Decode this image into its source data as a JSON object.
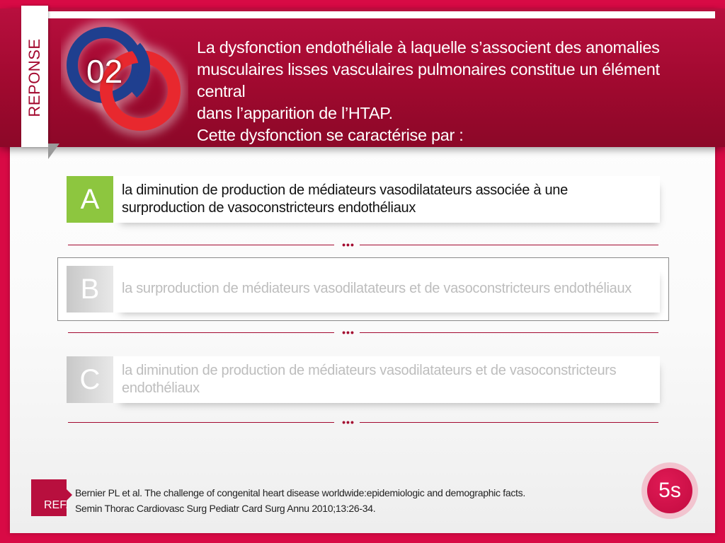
{
  "header": {
    "tab_label": "REPONSE",
    "question_number": "02",
    "question_lines": [
      "La dysfonction endothéliale à laquelle s’associent des anomalies",
      "musculaires lisses vasculaires pulmonaires constitue un élément central",
      "dans l’apparition de l’HTAP.",
      "Cette dysfonction se caractérise par :"
    ]
  },
  "options": [
    {
      "letter": "A",
      "text": "la diminution de production de médiateurs vasodilatateurs  associée à une surproduction de vasoconstricteurs endothéliaux",
      "state": "correct"
    },
    {
      "letter": "B",
      "text": "la surproduction de médiateurs vasodilatateurs et  de vasoconstricteurs endothéliaux",
      "state": "selected"
    },
    {
      "letter": "C",
      "text": "la diminution de production de médiateurs vasodilatateurs et de vasoconstricteurs endothéliaux",
      "state": "inactive"
    }
  ],
  "separator": {
    "dots": "•••"
  },
  "reference": {
    "label": "REF.",
    "lines": [
      "Bernier PL et al. The challenge of congenital heart disease worldwide:epidemiologic and demographic facts.",
      "Semin Thorac Cardiovasc Surg Pediatr Card Surg Annu 2010;13:26-34."
    ]
  },
  "timer": {
    "label": "5s"
  },
  "colors": {
    "brand": "#d80a45",
    "header": "#a3092f",
    "correct": "#8dc63f",
    "inactive_text": "#bdbdbd",
    "logo_blue": "#1f3f8f",
    "logo_red": "#e8282e"
  }
}
